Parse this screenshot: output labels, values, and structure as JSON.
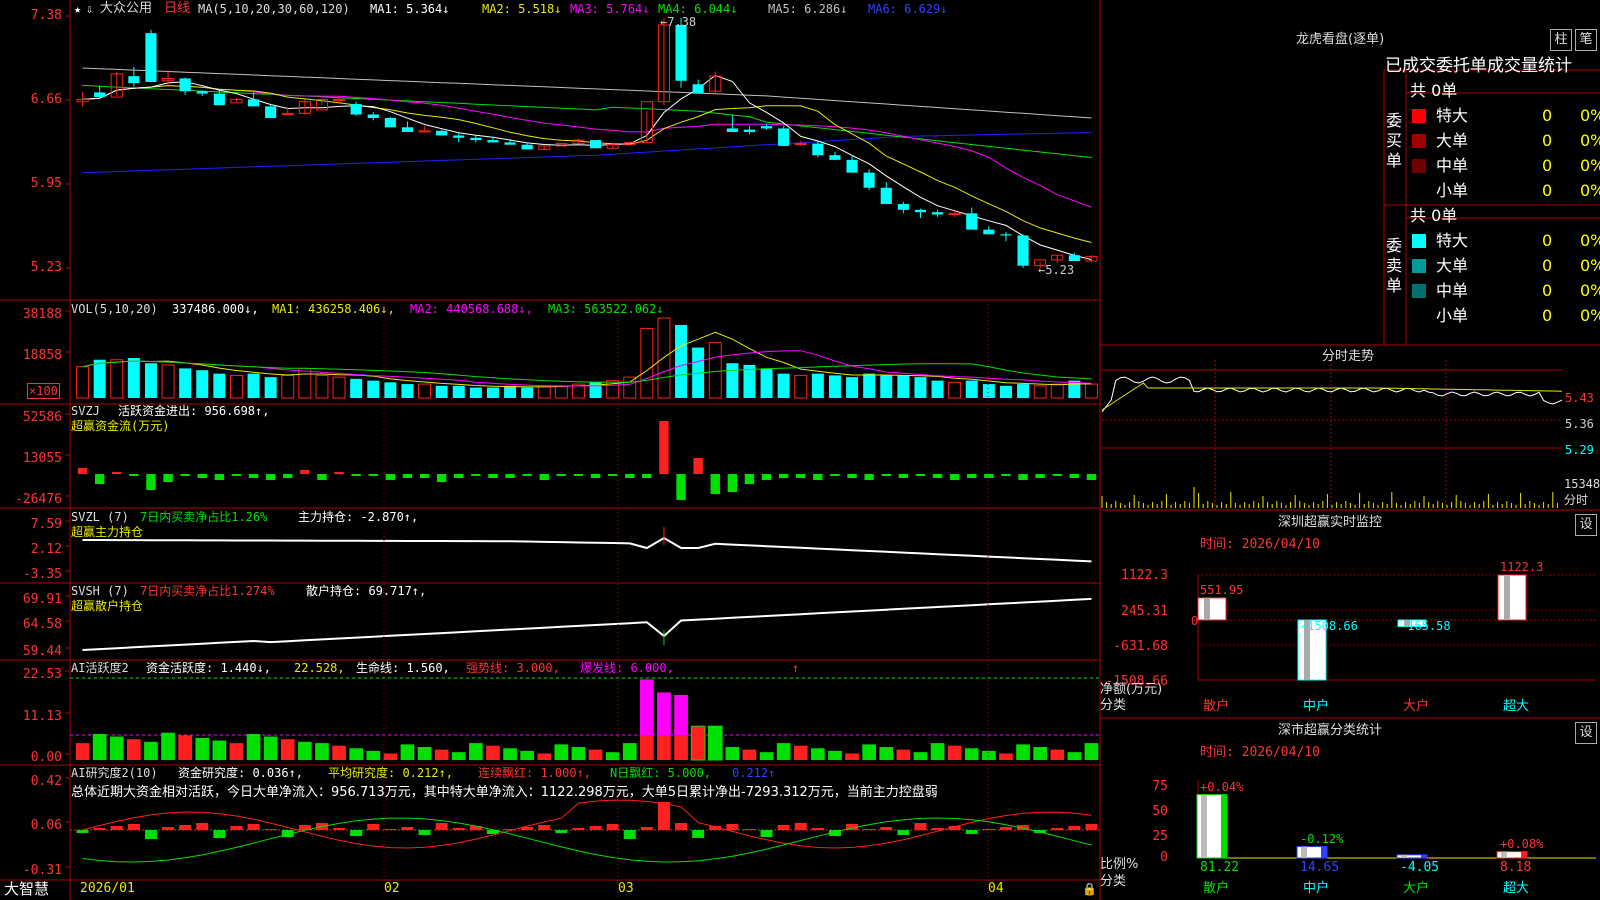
{
  "colors": {
    "grid": "#b00000",
    "up": "#ff2020",
    "down": "#00ffff",
    "ma1": "#ffffff",
    "ma2": "#e8e800",
    "ma3": "#ff00ff",
    "ma4": "#00e000",
    "ma5": "#c0c0c0",
    "ma6": "#2020ff",
    "green": "#00e000",
    "white": "#ffffff",
    "magenta": "#ff00ff"
  },
  "header": {
    "title": "大众公用",
    "period": "日线",
    "ma_params": "MA(5,10,20,30,60,120)",
    "ma1": "MA1: 5.364↓",
    "ma2": "MA2: 5.518↓",
    "ma3": "MA3: 5.764↓",
    "ma4": "MA4: 6.044↓",
    "ma5": "MA5: 6.286↓",
    "ma6": "MA6: 6.629↓"
  },
  "price_axis": [
    "7.38",
    "6.66",
    "5.95",
    "5.23"
  ],
  "price_annotations": {
    "high": "7.38",
    "low": "5.23"
  },
  "vol": {
    "label": "VOL(5,10,20)",
    "value": "337486.000↓,",
    "ma1": "MA1: 436258.406↓,",
    "ma2": "MA2: 440568.688↓,",
    "ma3": "MA3: 563522.062↓",
    "axis": [
      "38188",
      "18858"
    ],
    "unit": "×100"
  },
  "svzj": {
    "label": "SVZJ",
    "desc": "活跃资金进出: 956.698↑,",
    "sub": "超赢资金流(万元)",
    "axis": [
      "52586",
      "13055",
      "-26476"
    ]
  },
  "svzl": {
    "label": "SVZL (7)",
    "desc": "7日内买卖净占比1.26%",
    "hold": "主力持仓: -2.870↑,",
    "sub": "超赢主力持仓",
    "axis": [
      "7.59",
      "2.12",
      "-3.35"
    ]
  },
  "svsh": {
    "label": "SVSH (7)",
    "desc": "7日内买卖净占比1.274%",
    "hold": "散户持仓: 69.717↑,",
    "sub": "超赢散户持仓",
    "axis": [
      "69.91",
      "64.58",
      "59.44"
    ]
  },
  "ai2": {
    "label": "AI活跃度2",
    "p1": "资金活跃度: 1.440↓,",
    "p2": "22.528,",
    "p3": "生命线: 1.560,",
    "p4": "强势线: 3.000,",
    "p5": "爆发线: 6.000,",
    "arrow": "↑",
    "axis": [
      "22.53",
      "11.13",
      "0.00"
    ]
  },
  "ai_research": {
    "label": "AI研究度2(10)",
    "p1": "资金研究度: 0.036↑,",
    "p2": "平均研究度: 0.212↑,",
    "p3": "连续飘红: 1.000↑,",
    "p4": "N日飘红: 5.000,",
    "p5": "0.212↑",
    "summary": "总体近期大资金相对活跃，今日大单净流入：956.713万元，其中特大单净流入：1122.298万元，大单5日累计净出-7293.312万元，当前主力控盘弱",
    "axis": [
      "0.42",
      "0.06",
      "-0.31"
    ]
  },
  "footer": {
    "brand": "大智慧",
    "dates": [
      "2026/01",
      "02",
      "03",
      "04"
    ]
  },
  "dragon": {
    "title": "龙虎看盘(逐单)",
    "btn1": "柱",
    "btn2": "笔",
    "subtitle": "已成交委托单成交量统计",
    "buy_label": "委买单",
    "sell_label": "委卖单",
    "buy_total": "共 0单",
    "sell_total": "共 0单",
    "buy": [
      {
        "name": "特大",
        "v": "0",
        "p": "0%",
        "c": "#ff0000"
      },
      {
        "name": "大单",
        "v": "0",
        "p": "0%",
        "c": "#a00000"
      },
      {
        "name": "中单",
        "v": "0",
        "p": "0%",
        "c": "#700000"
      },
      {
        "name": "小单",
        "v": "0",
        "p": "0%",
        "c": "#000000"
      }
    ],
    "sell": [
      {
        "name": "特大",
        "v": "0",
        "p": "0%",
        "c": "#00ffff"
      },
      {
        "name": "大单",
        "v": "0",
        "p": "0%",
        "c": "#009a9a"
      },
      {
        "name": "中单",
        "v": "0",
        "p": "0%",
        "c": "#007070"
      },
      {
        "name": "小单",
        "v": "0",
        "p": "0%",
        "c": "#000000"
      }
    ]
  },
  "intraday": {
    "title": "分时走势",
    "axis": [
      "5.43",
      "5.36",
      "5.29"
    ],
    "vol_label": "15348",
    "vol_sub": "分时"
  },
  "sz_monitor": {
    "title": "深圳超赢实时监控",
    "set": "设",
    "time": "时间: 2026/04/10",
    "ylabel": "净额(万元)",
    "xlabel": "分类",
    "axis": [
      "1122.3",
      "245.31",
      "-631.68",
      "-1508.66"
    ],
    "zero": "0",
    "cats": [
      "散户",
      "中户",
      "大户",
      "超大"
    ],
    "values": [
      551.95,
      -1508.66,
      -165.58,
      1122.3
    ],
    "labels": [
      "551.95",
      "-1508.66",
      "-165.58",
      "1122.3"
    ]
  },
  "sz_class": {
    "title": "深市超赢分类统计",
    "set": "设",
    "time": "时间: 2026/04/10",
    "ylabel": "比例%",
    "xlabel": "分类",
    "axis": [
      "75",
      "50",
      "25",
      "0"
    ],
    "cats": [
      "散户",
      "中户",
      "大户",
      "超大"
    ],
    "pct_labels": [
      "+0.04%",
      "-0.12%",
      "",
      "+0.08%"
    ],
    "values": [
      "81.22",
      "14.65",
      "-4.05",
      "8.18"
    ],
    "bars": [
      81.22,
      14.65,
      4.05,
      8.18
    ]
  },
  "chart_data": [
    {
      "type": "candlestick",
      "title": "大众公用 日线",
      "ylim": [
        5.23,
        7.38
      ],
      "series": [
        {
          "name": "OHLC",
          "values": [
            [
              6.66,
              6.74,
              6.62,
              6.68
            ],
            [
              6.74,
              6.8,
              6.69,
              6.7
            ],
            [
              6.7,
              6.92,
              6.71,
              6.9
            ],
            [
              6.88,
              6.96,
              6.79,
              6.82
            ],
            [
              7.25,
              7.28,
              6.86,
              6.83
            ],
            [
              6.84,
              6.93,
              6.8,
              6.86
            ],
            [
              6.86,
              6.87,
              6.72,
              6.75
            ],
            [
              6.75,
              6.76,
              6.71,
              6.73
            ],
            [
              6.73,
              6.76,
              6.63,
              6.63
            ],
            [
              6.65,
              6.69,
              6.66,
              6.68
            ],
            [
              6.68,
              6.74,
              6.62,
              6.62
            ],
            [
              6.62,
              6.63,
              6.54,
              6.52
            ],
            [
              6.55,
              6.61,
              6.55,
              6.56
            ],
            [
              6.56,
              6.68,
              6.55,
              6.66
            ],
            [
              6.59,
              6.69,
              6.63,
              6.68
            ],
            [
              6.68,
              6.7,
              6.64,
              6.68
            ],
            [
              6.64,
              6.66,
              6.54,
              6.55
            ],
            [
              6.55,
              6.57,
              6.5,
              6.52
            ],
            [
              6.52,
              6.53,
              6.45,
              6.44
            ],
            [
              6.44,
              6.49,
              6.42,
              6.4
            ],
            [
              6.4,
              6.45,
              6.4,
              6.41
            ],
            [
              6.41,
              6.42,
              6.37,
              6.37
            ],
            [
              6.37,
              6.4,
              6.31,
              6.35
            ],
            [
              6.35,
              6.37,
              6.31,
              6.33
            ],
            [
              6.33,
              6.36,
              6.32,
              6.31
            ],
            [
              6.31,
              6.34,
              6.3,
              6.29
            ],
            [
              6.29,
              6.3,
              6.26,
              6.25
            ],
            [
              6.25,
              6.28,
              6.25,
              6.28
            ],
            [
              6.28,
              6.3,
              6.28,
              6.3
            ],
            [
              6.3,
              6.34,
              6.3,
              6.33
            ],
            [
              6.33,
              6.33,
              6.29,
              6.26
            ],
            [
              6.26,
              6.3,
              6.26,
              6.29
            ],
            [
              6.29,
              6.32,
              6.28,
              6.31
            ],
            [
              6.31,
              6.58,
              6.31,
              6.66
            ],
            [
              6.66,
              7.38,
              6.63,
              7.32
            ],
            [
              7.32,
              7.38,
              6.78,
              6.84
            ],
            [
              6.81,
              6.85,
              6.73,
              6.73
            ],
            [
              6.75,
              6.92,
              6.73,
              6.88
            ],
            [
              6.43,
              6.55,
              6.4,
              6.4
            ],
            [
              6.42,
              6.45,
              6.38,
              6.4
            ],
            [
              6.45,
              6.47,
              6.42,
              6.43
            ],
            [
              6.43,
              6.45,
              6.3,
              6.28
            ],
            [
              6.3,
              6.32,
              6.28,
              6.3
            ],
            [
              6.3,
              6.33,
              6.18,
              6.2
            ],
            [
              6.2,
              6.23,
              6.16,
              6.16
            ],
            [
              6.16,
              6.2,
              6.05,
              6.05
            ],
            [
              6.05,
              6.08,
              5.9,
              5.92
            ],
            [
              5.92,
              5.97,
              5.78,
              5.78
            ],
            [
              5.78,
              5.8,
              5.7,
              5.73
            ],
            [
              5.73,
              5.74,
              5.66,
              5.71
            ],
            [
              5.71,
              5.73,
              5.67,
              5.69
            ],
            [
              5.69,
              5.72,
              5.67,
              5.7
            ],
            [
              5.7,
              5.75,
              5.62,
              5.56
            ],
            [
              5.56,
              5.59,
              5.53,
              5.52
            ],
            [
              5.52,
              5.54,
              5.46,
              5.51
            ],
            [
              5.51,
              5.52,
              5.23,
              5.25
            ],
            [
              5.25,
              5.28,
              5.23,
              5.3
            ],
            [
              5.3,
              5.34,
              5.27,
              5.34
            ],
            [
              5.34,
              5.36,
              5.3,
              5.29
            ],
            [
              5.29,
              5.34,
              5.28,
              5.33
            ]
          ]
        }
      ]
    },
    {
      "type": "bar",
      "title": "VOL",
      "series": [
        {
          "name": "VOL",
          "values": [
            18,
            22,
            22,
            23,
            20,
            19,
            17,
            16,
            14,
            13,
            14,
            12,
            13,
            17,
            13,
            12,
            11,
            10,
            9,
            8,
            8,
            7,
            7,
            6,
            6,
            7,
            6,
            7,
            7,
            8,
            9,
            10,
            12,
            40,
            46,
            42,
            29,
            32,
            20,
            19,
            17,
            14,
            13,
            14,
            13,
            12,
            14,
            13,
            13,
            12,
            10,
            9,
            10,
            8,
            7,
            8,
            7,
            8,
            10,
            8
          ]
        }
      ]
    },
    {
      "type": "bar",
      "title": "SVZJ",
      "series": [
        {
          "name": "SVZJ",
          "values": [
            3,
            -5,
            1,
            -1,
            -8,
            -4,
            -1,
            -2,
            -3,
            -1,
            -2,
            -3,
            -2,
            2,
            -3,
            1,
            -1,
            -1,
            -3,
            -2,
            -2,
            -4,
            -2,
            -1,
            -2,
            -2,
            -1,
            -3,
            -1,
            -1,
            -2,
            -1,
            -2,
            -2,
            52586,
            -26476,
            8,
            -10,
            -9,
            -5,
            -3,
            -2,
            -2,
            -3,
            -1,
            -2,
            -3,
            -1,
            -2,
            -1,
            -2,
            -3,
            -2,
            -2,
            -1,
            -3,
            -2,
            -1,
            -2,
            -3
          ]
        }
      ]
    }
  ]
}
